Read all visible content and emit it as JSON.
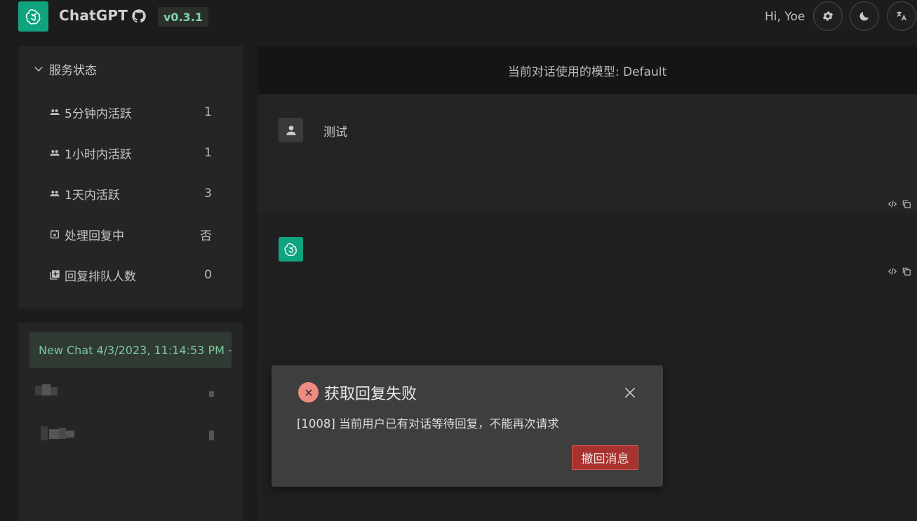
{
  "header": {
    "app_title": "ChatGPT",
    "version": "v0.3.1",
    "greeting": "Hi, Yoe",
    "icons": [
      "openai-logo-icon",
      "github-icon",
      "gear-icon",
      "moon-icon",
      "translate-icon"
    ]
  },
  "sidebar": {
    "status_title": "服务状态",
    "status_items": [
      {
        "label": "5分钟内活跃",
        "value": "1",
        "icon": "users-icon"
      },
      {
        "label": "1小时内活跃",
        "value": "1",
        "icon": "users-icon"
      },
      {
        "label": "1天内活跃",
        "value": "3",
        "icon": "users-icon"
      },
      {
        "label": "处理回复中",
        "value": "否",
        "icon": "calendar-x-icon"
      },
      {
        "label": "回复排队人数",
        "value": "0",
        "icon": "queue-add-icon"
      }
    ],
    "chats": [
      {
        "title": "New Chat 4/3/2023, 11:14:53 PM -",
        "active": true
      }
    ]
  },
  "main": {
    "model_label": "当前对话使用的模型: Default",
    "messages": [
      {
        "role": "user",
        "text": "测试"
      },
      {
        "role": "assistant",
        "text": ""
      }
    ]
  },
  "dialog": {
    "title": "获取回复失败",
    "body": "[1008] 当前用户已有对话等待回复，不能再次请求",
    "action_label": "撤回消息"
  },
  "colors": {
    "accent": "#10a37f",
    "error": "#f08a80",
    "danger_button": "#a8322e",
    "active_chat_text": "#7ec7a0"
  }
}
